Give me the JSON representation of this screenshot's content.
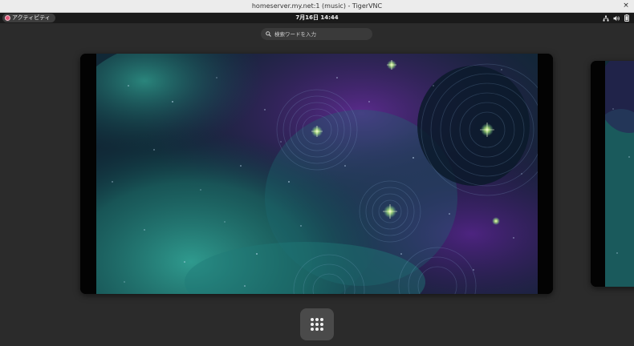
{
  "window": {
    "title": "homeserver.my.net:1 (music) - TigerVNC",
    "close_glyph": "×"
  },
  "topbar": {
    "activities_label": "アクティビティ",
    "clock": "7月16日  14:44",
    "tray_icons": [
      "network-icon",
      "volume-icon",
      "battery-icon"
    ]
  },
  "search": {
    "placeholder": "検索ワードを入力"
  },
  "workspaces": [
    {
      "name": "current-workspace",
      "wallpaper": "nebula-teal-purple"
    },
    {
      "name": "next-workspace",
      "wallpaper": "nebula-teal-purple"
    }
  ],
  "dock": {
    "app_grid_icon": "show-apps-grid-icon"
  },
  "colors": {
    "shell_background": "#2b2b2b",
    "topbar_background": "#1a1a1a",
    "activities_dot": "#e05a7a",
    "nebula_teal": "#1f7f7a",
    "nebula_purple": "#4a1e6e"
  }
}
